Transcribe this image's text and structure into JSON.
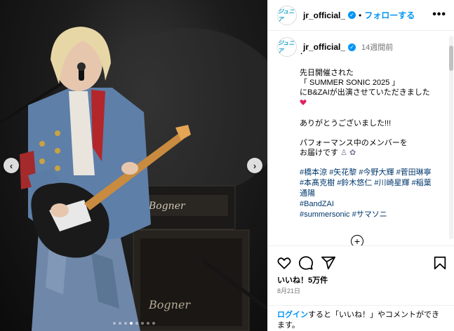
{
  "account": {
    "username": "jr_official_",
    "avatar_text": "ジュニア",
    "separator": "•",
    "follow_label": "フォローする",
    "more_label": "•••"
  },
  "caption": {
    "time": "14週間前",
    "lines": [
      "．",
      "先日開催された",
      "「 SUMMER SONIC 2025 」",
      "にB&ZAIが出演させていただきました",
      "ありがとうございました!!!",
      "パフォーマンス中のメンバーを",
      "お届けです"
    ],
    "hashtags_line1": [
      "#橋本涼",
      "#矢花黎",
      "#今野大輝",
      "#菅田琳寧"
    ],
    "hashtags_line2": [
      "#本髙克樹",
      "#鈴木悠仁",
      "#川崎星輝",
      "#稲葉"
    ],
    "hashtags_line3": "通陽",
    "hashtags_line4": "#BandZAI",
    "hashtags_line5": [
      "#summersonic",
      "#サマソニ"
    ]
  },
  "stats": {
    "likes": "いいね！5万件",
    "date": "8月21日"
  },
  "login": {
    "link": "ログイン",
    "text": "すると「いいね！」やコメントができます。"
  },
  "photo": {
    "amp_brand_top": "Bogner",
    "amp_brand_bottom": "Bogner",
    "slides": 8,
    "active_slide": 3
  },
  "icons": {
    "verified": "verified-badge-icon",
    "heart": "heart-icon",
    "comment": "comment-icon",
    "share": "share-icon",
    "save": "bookmark-icon",
    "more": "more-icon",
    "prev": "chevron-left-icon",
    "next": "chevron-right-icon",
    "plus": "plus-circle-icon"
  },
  "colors": {
    "accent": "#0095f6",
    "hashtag": "#00376b",
    "muted": "#737373"
  }
}
